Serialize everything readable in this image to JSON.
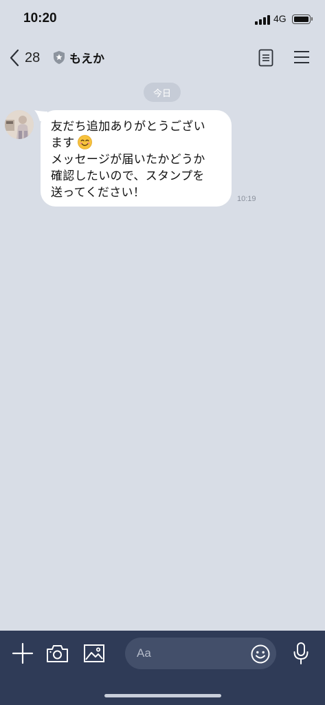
{
  "status_bar": {
    "time": "10:20",
    "network": "4G",
    "icons": [
      "signal-icon",
      "battery-icon"
    ]
  },
  "nav": {
    "back_count": "28",
    "title": "もえか",
    "icons": [
      "chevron-left-icon",
      "star-shield-icon",
      "notes-icon",
      "menu-icon"
    ]
  },
  "chat": {
    "date_label": "今日",
    "messages": [
      {
        "lines": [
          "友だち追加ありがとうござい",
          "ます",
          "メッセージが届いたかどうか",
          "確認したいので、スタンプを",
          "送ってください！"
        ],
        "emoji": "smiling-face-icon",
        "time": "10:19"
      }
    ]
  },
  "input_bar": {
    "placeholder": "Aa",
    "icons": [
      "plus-icon",
      "camera-icon",
      "image-icon",
      "emoji-icon",
      "mic-icon"
    ]
  },
  "colors": {
    "background": "#d8dde6",
    "bubble": "#ffffff",
    "input_bar": "#2f3b57",
    "input_field": "#434f6a"
  }
}
